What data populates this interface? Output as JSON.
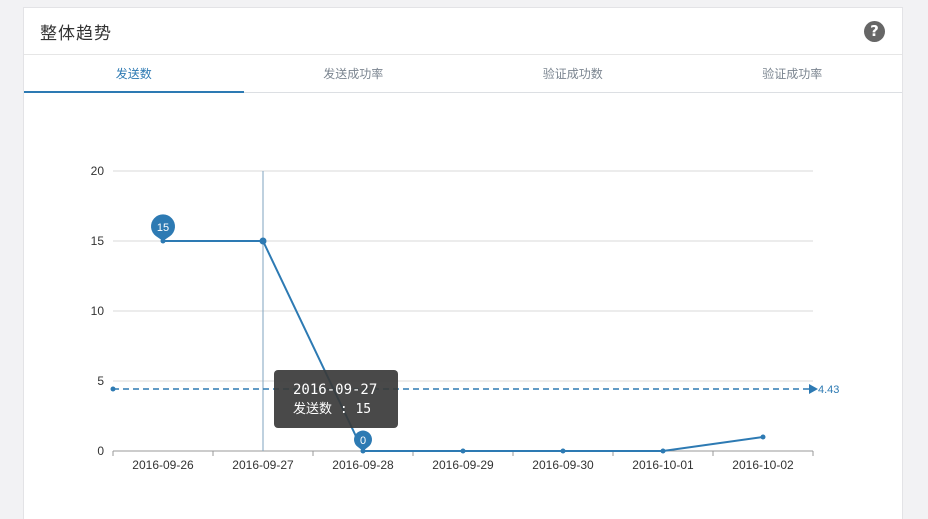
{
  "panel": {
    "title": "整体趋势",
    "help_icon": "question-circle-icon"
  },
  "tabs": [
    {
      "label": "发送数",
      "active": true
    },
    {
      "label": "发送成功率",
      "active": false
    },
    {
      "label": "验证成功数",
      "active": false
    },
    {
      "label": "验证成功率",
      "active": false
    }
  ],
  "colors": {
    "series": "#2d7ab3",
    "grid": "#d9d9d9",
    "tooltip_bg": "#3a3a3a"
  },
  "chart_data": {
    "type": "line",
    "categories": [
      "2016-09-26",
      "2016-09-27",
      "2016-09-28",
      "2016-09-29",
      "2016-09-30",
      "2016-10-01",
      "2016-10-02"
    ],
    "series": [
      {
        "name": "发送数",
        "values": [
          15,
          15,
          0,
          0,
          0,
          0,
          1
        ]
      }
    ],
    "ylim": [
      0,
      20
    ],
    "yticks": [
      0,
      5,
      10,
      15,
      20
    ],
    "grid": true,
    "mark_points": [
      {
        "label": "15",
        "index": 0,
        "value": 15
      },
      {
        "label": "0",
        "index": 2,
        "value": 0
      }
    ],
    "mark_line": {
      "value": 4.43,
      "label": "4.43"
    },
    "tooltip": {
      "index": 1,
      "title": "2016-09-27",
      "text": "发送数 : 15"
    }
  }
}
